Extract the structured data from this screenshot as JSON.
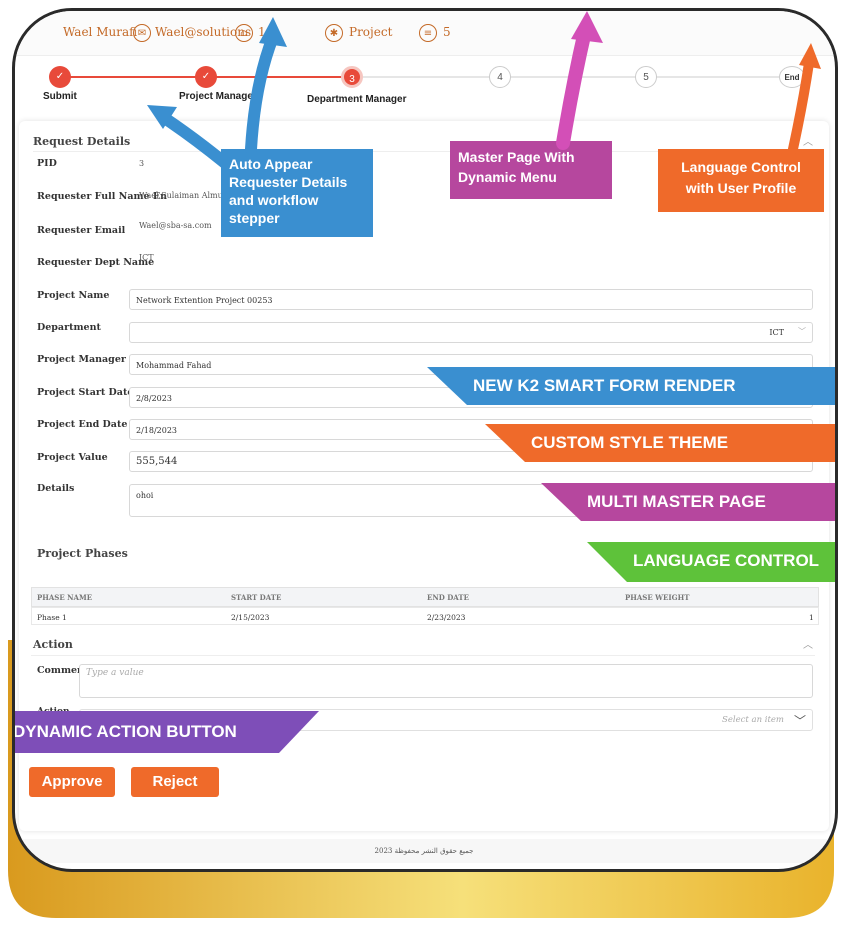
{
  "topbar": {
    "user_name": "Wael Murafi",
    "email": "Wael@solutions",
    "item_3": "1",
    "project": "Project",
    "count": "5"
  },
  "stepper": {
    "steps": [
      {
        "label": "Submit",
        "state": "done"
      },
      {
        "label": "Project Manager",
        "state": "done"
      },
      {
        "label": "Department Manager",
        "number": "3",
        "state": "current"
      },
      {
        "number": "4",
        "state": "pending"
      },
      {
        "number": "5",
        "state": "pending"
      },
      {
        "number": "End",
        "state": "pending"
      }
    ]
  },
  "request_details": {
    "title": "Request Details",
    "pid_label": "PID",
    "pid_value": "3",
    "name_label": "Requester Full Name En",
    "name_value": "Wael Sulaiman Almurafi",
    "email_label": "Requester Email",
    "email_value": "Wael@sba-sa.com",
    "dept_label": "Requester Dept Name",
    "dept_value": "ICT"
  },
  "form": {
    "project_name_label": "Project Name",
    "project_name_value": "Network Extention Project 00253",
    "department_label": "Department",
    "department_value": "ICT",
    "manager_label": "Project Manager",
    "manager_value": "Mohammad Fahad",
    "start_label": "Project Start Date",
    "start_value": "2/8/2023",
    "end_label": "Project End Date",
    "end_value": "2/18/2023",
    "value_label": "Project Value",
    "value_value": "555,544",
    "details_label": "Details",
    "details_value": "ohoi"
  },
  "phases": {
    "title": "Project Phases",
    "columns": [
      "PHASE NAME",
      "START DATE",
      "END DATE",
      "PHASE WEIGHT"
    ],
    "rows": [
      {
        "name": "Phase 1",
        "start": "2/15/2023",
        "end": "2/23/2023",
        "weight": "1"
      }
    ]
  },
  "action": {
    "title": "Action",
    "comment_label": "Comment",
    "comment_placeholder": "Type a value",
    "action_label": "Action",
    "select_placeholder": "Select an item",
    "approve": "Approve",
    "reject": "Reject"
  },
  "footer": {
    "text": "جميع حقوق النشر محفوظة 2023"
  },
  "callouts": {
    "auto_appear": "Auto Appear Requester Details and workflow stepper",
    "master_page": "Master Page With Dynamic Menu",
    "language": "Language Control with User Profile"
  },
  "ribbons": {
    "k2": "NEW K2 SMART FORM RENDER",
    "style": "CUSTOM STYLE THEME",
    "multi": "MULTI MASTER PAGE",
    "lang": "LANGUAGE CONTROL",
    "dynamic": "DYNAMIC ACTION BUTTON"
  },
  "colors": {
    "accent": "#e84a3a",
    "orange": "#ef6a2a",
    "blue": "#3a8fd0",
    "purple": "#b6479e",
    "green": "#5ec23a",
    "violet": "#7e4eb8",
    "gold": "#f2b632"
  },
  "icons": [
    "envelope-icon",
    "bank-icon",
    "gear-icon",
    "coins-icon",
    "chevron-down-icon",
    "chevron-up-icon",
    "check-icon"
  ]
}
